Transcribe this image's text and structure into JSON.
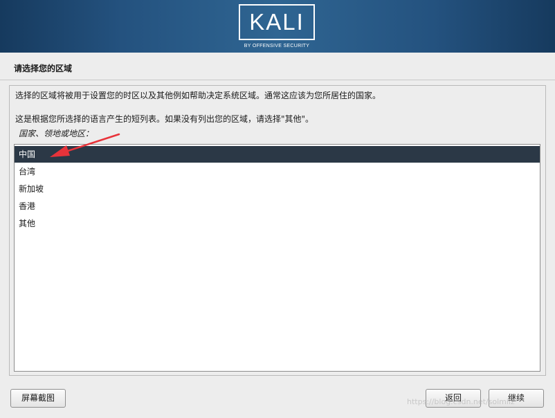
{
  "banner": {
    "logo_word": "KALI",
    "logo_sub": "BY OFFENSIVE SECURITY"
  },
  "page": {
    "title": "请选择您的区域",
    "description_1": "选择的区域将被用于设置您的时区以及其他例如帮助决定系统区域。通常这应该为您所居住的国家。",
    "description_2": "这是根据您所选择的语言产生的短列表。如果没有列出您的区域，请选择\"其他\"。",
    "list_label": "国家、领地或地区："
  },
  "region_list": {
    "items": [
      {
        "label": "中国",
        "selected": true
      },
      {
        "label": "台湾",
        "selected": false
      },
      {
        "label": "新加坡",
        "selected": false
      },
      {
        "label": "香港",
        "selected": false
      },
      {
        "label": "其他",
        "selected": false
      }
    ]
  },
  "buttons": {
    "screenshot": "屏幕截图",
    "back": "返回",
    "continue": "继续"
  },
  "annotation": {
    "arrow_color": "#e8333a"
  },
  "watermark": "https://blog.csdn.net/solmilz"
}
